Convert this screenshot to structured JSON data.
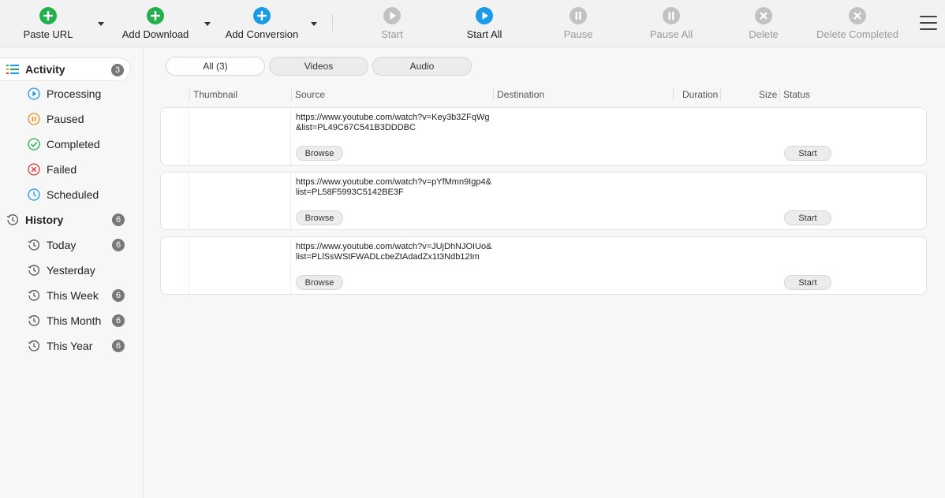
{
  "toolbar": {
    "paste_url": "Paste URL",
    "add_download": "Add Download",
    "add_conversion": "Add Conversion",
    "start": "Start",
    "start_all": "Start All",
    "pause": "Pause",
    "pause_all": "Pause All",
    "delete": "Delete",
    "delete_completed": "Delete Completed",
    "colors": {
      "green": "#22b14c",
      "blue": "#1a9be8",
      "gray": "#c2c2c2"
    }
  },
  "sidebar": {
    "activity": {
      "label": "Activity",
      "count": "3"
    },
    "processing": "Processing",
    "paused": "Paused",
    "completed": "Completed",
    "failed": "Failed",
    "scheduled": "Scheduled",
    "history": {
      "label": "History",
      "count": "6"
    },
    "today": {
      "label": "Today",
      "count": "6"
    },
    "yesterday": {
      "label": "Yesterday"
    },
    "this_week": {
      "label": "This Week",
      "count": "6"
    },
    "this_month": {
      "label": "This Month",
      "count": "6"
    },
    "this_year": {
      "label": "This Year",
      "count": "6"
    }
  },
  "filters": {
    "all": "All (3)",
    "videos": "Videos",
    "audio": "Audio"
  },
  "columns": {
    "thumbnail": "Thumbnail",
    "source": "Source",
    "destination": "Destination",
    "duration": "Duration",
    "size": "Size",
    "status": "Status"
  },
  "rows": [
    {
      "source": "https://www.youtube.com/watch?v=Key3b3ZFqWg&list=PL49C67C541B3DDDBC",
      "browse": "Browse",
      "start": "Start"
    },
    {
      "source": "https://www.youtube.com/watch?v=pYfMmn9Igp4&list=PL58F5993C5142BE3F",
      "browse": "Browse",
      "start": "Start"
    },
    {
      "source": "https://www.youtube.com/watch?v=JUjDhNJOIUo&list=PLlSsWStFWADLcbeZtAdadZx1t3Ndb12Im",
      "browse": "Browse",
      "start": "Start"
    }
  ]
}
